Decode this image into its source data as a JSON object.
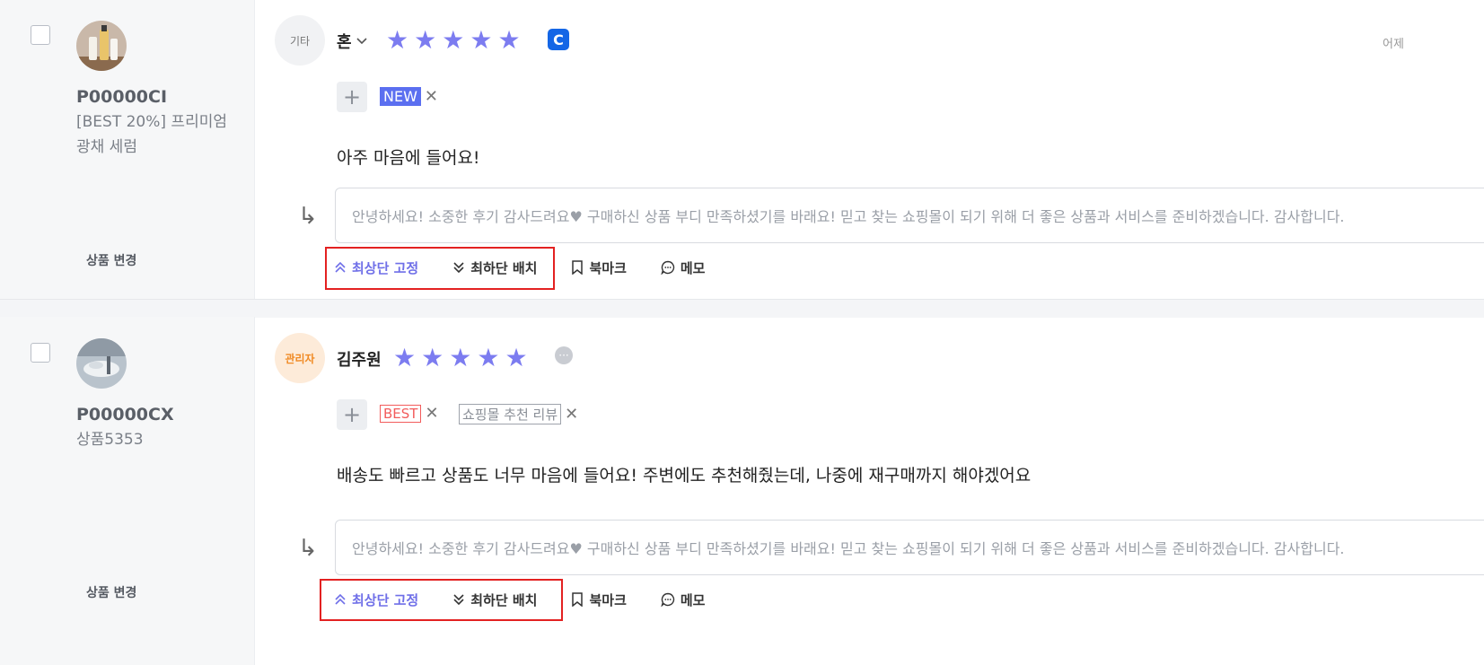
{
  "reviews": [
    {
      "product_code": "P00000CI",
      "product_name": "[BEST 20%] 프리미엄 광채 세럼",
      "change_label": "상품 변경",
      "badge": "기타",
      "author": "혼",
      "author_icon": "chevron-down-icon",
      "rating": 5,
      "channel_badge": "C",
      "date": "어제",
      "tags": [
        {
          "label": "NEW",
          "style": "filled",
          "color": "#5b6ff0"
        }
      ],
      "content": "아주 마음에 들어요!",
      "reply_placeholder": "안녕하세요! 소중한 후기 감사드려요♥ 구매하신 상품 부디 만족하셨기를 바래요! 믿고 찾는 쇼핑몰이 되기 위해 더 좋은 상품과 서비스를 준비하겠습니다. 감사합니다.",
      "actions": [
        "최상단 고정",
        "최하단 배치",
        "북마크",
        "메모"
      ]
    },
    {
      "product_code": "P00000CX",
      "product_name": "상품5353",
      "change_label": "상품 변경",
      "badge": "관리자",
      "author": "김주원",
      "rating": 5,
      "tags": [
        {
          "label": "BEST",
          "style": "outline",
          "color": "#f25c5c"
        },
        {
          "label": "쇼핑몰 추천 리뷰",
          "style": "outline",
          "color": "#9ea3ab"
        }
      ],
      "content": "배송도 빠르고 상품도 너무 마음에 들어요! 주변에도 추천해줬는데, 나중에 재구매까지 해야겠어요",
      "reply_placeholder": "안녕하세요! 소중한 후기 감사드려요♥ 구매하신 상품 부디 만족하셨기를 바래요! 믿고 찾는 쇼핑몰이 되기 위해 더 좋은 상품과 서비스를 준비하겠습니다. 감사합니다.",
      "actions": [
        "최상단 고정",
        "최하단 배치",
        "북마크",
        "메모"
      ]
    }
  ],
  "colors": {
    "star": "#7c7cf0",
    "highlight_box": "#e32121",
    "pin_action": "#6f6fe8"
  }
}
